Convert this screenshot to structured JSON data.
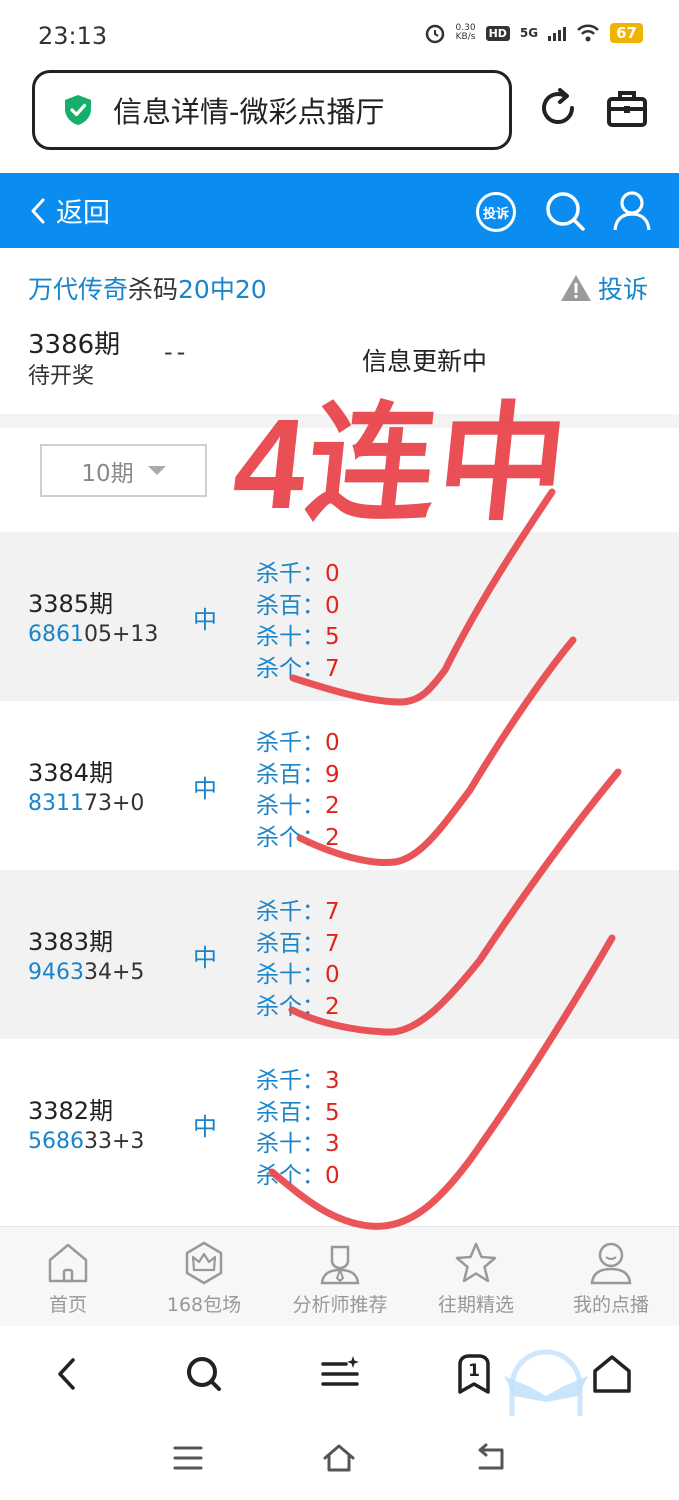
{
  "status_bar": {
    "time": "23:13",
    "net_speed_value": "0.30",
    "net_speed_unit": "KB/s",
    "hd": "HD",
    "network": "5G",
    "battery": "67"
  },
  "browser": {
    "title": "信息详情-微彩点播厅"
  },
  "header": {
    "back_label": "返回",
    "complain_badge": "投诉"
  },
  "info": {
    "title_part1": "万代传奇",
    "title_part2": "杀码",
    "title_part3": "20中20",
    "complain_label": "投诉",
    "pending_period": "3386期",
    "pending_status": "待开奖",
    "pending_dash": "--",
    "pending_message": "信息更新中"
  },
  "period_select": {
    "value": "10期"
  },
  "records": [
    {
      "period": "3385期",
      "code_hl": "6861",
      "code_rest": "05+13",
      "result": "中",
      "kills": [
        {
          "label": "杀千：",
          "value": "0"
        },
        {
          "label": "杀百：",
          "value": "0"
        },
        {
          "label": "杀十：",
          "value": "5"
        },
        {
          "label": "杀个：",
          "value": "7"
        }
      ]
    },
    {
      "period": "3384期",
      "code_hl": "8311",
      "code_rest": "73+0",
      "result": "中",
      "kills": [
        {
          "label": "杀千：",
          "value": "0"
        },
        {
          "label": "杀百：",
          "value": "9"
        },
        {
          "label": "杀十：",
          "value": "2"
        },
        {
          "label": "杀个：",
          "value": "2"
        }
      ]
    },
    {
      "period": "3383期",
      "code_hl": "9463",
      "code_rest": "34+5",
      "result": "中",
      "kills": [
        {
          "label": "杀千：",
          "value": "7"
        },
        {
          "label": "杀百：",
          "value": "7"
        },
        {
          "label": "杀十：",
          "value": "0"
        },
        {
          "label": "杀个：",
          "value": "2"
        }
      ]
    },
    {
      "period": "3382期",
      "code_hl": "5686",
      "code_rest": "33+3",
      "result": "中",
      "kills": [
        {
          "label": "杀千：",
          "value": "3"
        },
        {
          "label": "杀百：",
          "value": "5"
        },
        {
          "label": "杀十：",
          "value": "3"
        },
        {
          "label": "杀个：",
          "value": "0"
        }
      ]
    }
  ],
  "bottom_nav": {
    "items": [
      {
        "label": "首页",
        "icon": "home-icon"
      },
      {
        "label": "168包场",
        "icon": "crown-icon"
      },
      {
        "label": "分析师推荐",
        "icon": "analyst-icon"
      },
      {
        "label": "往期精选",
        "icon": "star-icon"
      },
      {
        "label": "我的点播",
        "icon": "user-icon"
      }
    ]
  },
  "browser_toolbar": {
    "tab_count": "1"
  },
  "annotation": {
    "text": "4连中"
  },
  "colors": {
    "header_blue": "#0a8cf0",
    "link_blue": "#1a85c9",
    "value_red": "#e0241b",
    "annotation_red": "#e8464b"
  }
}
